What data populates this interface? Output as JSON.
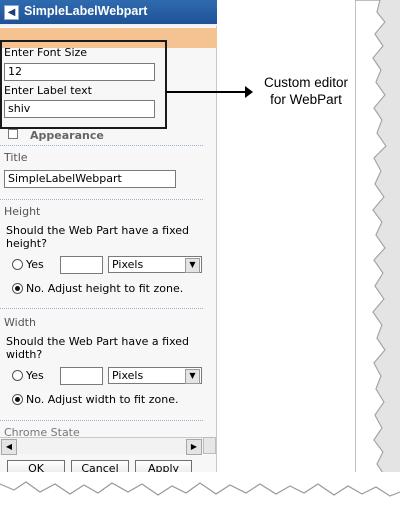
{
  "pane": {
    "title": "SimpleLabelWebpart",
    "custom": {
      "font_size_label": "Enter Font Size",
      "font_size_value": "12",
      "label_text_label": "Enter Label text",
      "label_text_value": "shiv"
    },
    "appearance": "Appearance",
    "title_section": {
      "label": "Title",
      "value": "SimpleLabelWebpart"
    },
    "height": {
      "header": "Height",
      "question_line1": "Should the Web Part have a fixed",
      "question_line2": "height?",
      "yes": "Yes",
      "units": "Pixels",
      "no": "No. Adjust height to fit zone."
    },
    "width": {
      "header": "Width",
      "question_line1": "Should the Web Part have a fixed",
      "question_line2": "width?",
      "yes": "Yes",
      "units": "Pixels",
      "no": "No. Adjust width to fit zone."
    },
    "chrome_state": "Chrome State",
    "buttons": {
      "ok": "OK",
      "cancel": "Cancel",
      "apply": "Apply"
    }
  },
  "annotation": {
    "line1": "Custom editor",
    "line2": "for WebPart"
  },
  "colors": {
    "titlebar": "#1f5196",
    "orange_band": "#f5c292",
    "pane_bg": "#f7f7f7"
  }
}
